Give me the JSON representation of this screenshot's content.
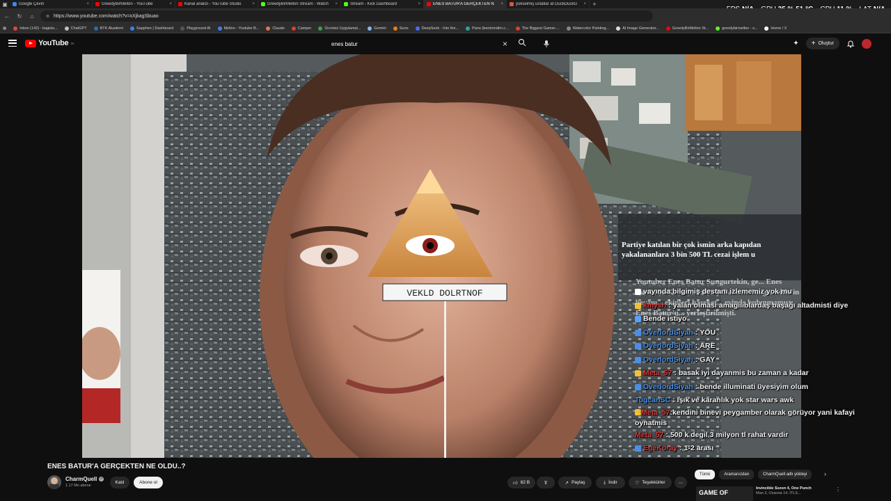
{
  "browser": {
    "tabs": [
      {
        "label": "Google Çeviri",
        "color": "#4285f4",
        "active": false
      },
      {
        "label": "GreedyBirMellon - YouTube",
        "color": "#ff0000",
        "active": false
      },
      {
        "label": "Kanal analizi - YouTube Studio",
        "color": "#ff0000",
        "active": false
      },
      {
        "label": "GreedyBirMellon Stream - Watch",
        "color": "#53fc18",
        "active": false
      },
      {
        "label": "Stream - Kick Dashboard",
        "color": "#53fc18",
        "active": false
      },
      {
        "label": "ENES BATUR'A GERÇEKTEN N",
        "color": "#ff0000",
        "active": true
      },
      {
        "label": "yükselmiş üstatlar at DuckDuckG",
        "color": "#de5833",
        "active": false
      }
    ],
    "url": "https://www.youtube.com/watch?v=xXjkagSbuao",
    "bookmarks": [
      {
        "label": "Inbox (142) - bagisis...",
        "color": "#ea4335"
      },
      {
        "label": "ChatGPT",
        "color": "#bfbfbf"
      },
      {
        "label": "BTK Akademi",
        "color": "#2b6cb0"
      },
      {
        "label": "Sapphire | Dashboard",
        "color": "#3b82f6"
      },
      {
        "label": "Playground AI",
        "color": "#555555"
      },
      {
        "label": "Mellon - Youtube B...",
        "color": "#3b82f6"
      },
      {
        "label": "Claude",
        "color": "#d97757"
      },
      {
        "label": "Camper",
        "color": "#e53935"
      },
      {
        "label": "Ücretsiz Uygulamal...",
        "color": "#43a047"
      },
      {
        "label": "Gemini",
        "color": "#8ab4f8"
      },
      {
        "label": "Suno",
        "color": "#f57c00"
      },
      {
        "label": "DeepSeek - Into the...",
        "color": "#4d6bfe"
      },
      {
        "label": "Pano (bentrendim.c...",
        "color": "#26a69a"
      },
      {
        "label": "The Biggest Gamer-...",
        "color": "#e53935"
      },
      {
        "label": "Watercolor Painting...",
        "color": "#888888"
      },
      {
        "label": "AI Image Generator...",
        "color": "#dddddd"
      },
      {
        "label": "GreedyBirMellon St...",
        "color": "#ff0000"
      },
      {
        "label": "greedybirmellon - s...",
        "color": "#53fc18"
      },
      {
        "label": "Home / X",
        "color": "#ffffff"
      }
    ]
  },
  "hud": {
    "fps_label": "FPS",
    "fps_value": "N/A",
    "gpu_label": "GPU",
    "gpu_value": "35 % 51 °C",
    "cpu_label": "CPU",
    "cpu_value": "11 %",
    "lat_label": "LAT",
    "lat_value": "N/A"
  },
  "youtube": {
    "logo_text": "YouTube",
    "logo_country": "TR",
    "search_value": "enes batur",
    "create_label": "Oluştur"
  },
  "video": {
    "eye_caption": "VEKLD DOLRTNOF",
    "news_headline": "Partiye katılan bir çok ismin arka kapıdan yakalananlara 3 bin 500 TL cezai işlem u",
    "news_body": "Youtuber Enes Batur Sungurtekin, ge... Enes Batur'un Koronavirüs'e yakalan... Sungurtekin'in beyanı... ekipleri hareket... evinde bulunmamıştı. Enes Batur'u... yerleştirilmişti."
  },
  "chat": [
    {
      "user": "",
      "user_color": "#ffffff",
      "badge": "#ffffff",
      "text": "vayında bilgimiş destanı izlememiz yok mu"
    },
    {
      "user": "kmysh",
      "user_color": "#d13b3b",
      "badge": "#f2c037",
      "text": "yalan olması amagiliblardaş başağı altadmisti diye"
    },
    {
      "user": "",
      "user_color": "#ffffff",
      "badge": "#5aa0ff",
      "text": "Bende istiyo"
    },
    {
      "user": "OverlordSiyah",
      "user_color": "#4a8fe7",
      "badge": "#4a8fe7",
      "text": "YOU"
    },
    {
      "user": "OverlordSiyah",
      "user_color": "#4a8fe7",
      "badge": "#4a8fe7",
      "text": "ARE"
    },
    {
      "user": "OverlordSiyah",
      "user_color": "#4a8fe7",
      "badge": "#4a8fe7",
      "text": "GAY"
    },
    {
      "user": "Meta_57",
      "user_color": "#d13b3b",
      "badge": "#f2c037",
      "text": "basak iyi dayanmis bu zaman a kadar"
    },
    {
      "user": "OverlordSiyah",
      "user_color": "#4a8fe7",
      "badge": "#4a8fe7",
      "text": "bende illuminati üyesiyim olum"
    },
    {
      "user": "TugcanSC",
      "user_color": "#4a8fe7",
      "badge": "",
      "text": "ışık ve karanlık yok star wars awk"
    },
    {
      "user": "Meta_57",
      "user_color": "#d13b3b",
      "badge": "#f2c037",
      "text": "kendini binevi peygamber olarak görüyor yani kafayi oynatmis",
      "wrap": true
    },
    {
      "user": "Meta_57",
      "user_color": "#d13b3b",
      "badge": "",
      "text": "500 k degil 3 milyon tl rahat vardir"
    },
    {
      "user": "EgeKoray",
      "user_color": "#d13b3b",
      "badge": "#4a8fe7",
      "text": "1-2 arası"
    }
  ],
  "below": {
    "title": "ENES BATUR'A GERÇEKTEN NE OLDU..?",
    "channel_name": "CharmQuell",
    "subs": "1.17 Mn abone",
    "join_label": "Katıl",
    "subscribe_label": "Abone ol",
    "likes": "82 B",
    "share_label": "Paylaş",
    "download_label": "İndir",
    "thanks_label": "Teşekkürler",
    "more_label": "⋯"
  },
  "chips": [
    "Tümü",
    "Aramanızdan",
    "CharmQuell adlı yükleyi"
  ],
  "next_video": {
    "thumb_text": "GAME OF",
    "title": "Invincible Sezon 4, One Punch",
    "meta": "Man 3, Ozaoria 14, İTLS..."
  },
  "colors": {
    "bg": "#0f0f0f",
    "yt_red": "#ff0000",
    "chip_bg": "#272727"
  }
}
